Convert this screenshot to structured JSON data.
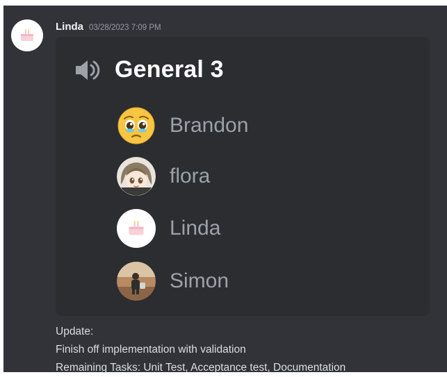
{
  "message": {
    "author": "Linda",
    "timestamp": "03/28/2023 7:09 PM",
    "avatar_icon": "cake-avatar-icon"
  },
  "voice_embed": {
    "channel_icon": "speaker-icon",
    "channel_name": "General 3",
    "members": [
      {
        "name": "Brandon",
        "avatar_icon": "pleading-face-emoji-icon"
      },
      {
        "name": "flora",
        "avatar_icon": "anime-girl-avatar-icon"
      },
      {
        "name": "Linda",
        "avatar_icon": "cake-avatar-icon"
      },
      {
        "name": "Simon",
        "avatar_icon": "photo-avatar-icon"
      }
    ]
  },
  "content": {
    "lines": [
      "Update:",
      "Finish off implementation with validation",
      "Remaining Tasks: Unit Test, Acceptance test, Documentation"
    ]
  },
  "colors": {
    "background": "#313338",
    "embed_background": "#2b2d31",
    "author": "#f2f3f5",
    "timestamp": "#949ba4",
    "member_name": "#9ca2a9",
    "text": "#dbdee1"
  }
}
